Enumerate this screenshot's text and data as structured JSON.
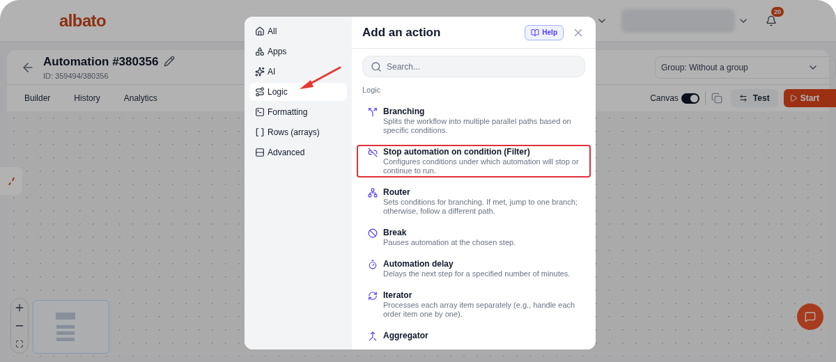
{
  "header": {
    "logo": "albato",
    "notifications": {
      "count": "20"
    }
  },
  "automation": {
    "title": "Automation #380356",
    "id": "ID: 359494/380356",
    "group": "Group: Without a group",
    "tabs": [
      {
        "label": "Builder"
      },
      {
        "label": "History"
      },
      {
        "label": "Analytics"
      }
    ],
    "canvas_toggle": {
      "label": "Canvas",
      "on": true
    },
    "buttons": [
      {
        "label": "Test",
        "kind": "secondary"
      },
      {
        "label": "Start",
        "kind": "primary"
      }
    ]
  },
  "modal": {
    "title": "Add an action",
    "help": "Help",
    "search": {
      "placeholder": "Search..."
    },
    "section": "Logic",
    "categories": [
      {
        "label": "All",
        "kind": "house",
        "selected": false
      },
      {
        "label": "Apps",
        "kind": "shapes",
        "selected": false
      },
      {
        "label": "AI",
        "kind": "sparkles",
        "selected": false
      },
      {
        "label": "Logic",
        "kind": "route",
        "selected": true
      },
      {
        "label": "Formatting",
        "kind": "terminal",
        "selected": false
      },
      {
        "label": "Rows (arrays)",
        "kind": "brackets",
        "selected": false
      },
      {
        "label": "Advanced",
        "kind": "rows",
        "selected": false
      }
    ],
    "actions": [
      {
        "name": "Branching",
        "description": "Splits the workflow into multiple parallel paths based on specific conditions.",
        "kind": "split",
        "highlighted": false
      },
      {
        "name": "Stop automation on condition (Filter)",
        "description": "Configures conditions under which automation will stop or continue to run.",
        "kind": "unlink",
        "highlighted": true
      },
      {
        "name": "Router",
        "description": "Sets conditions for branching. If met, jump to one branch; otherwise, follow a different path.",
        "kind": "network",
        "highlighted": false
      },
      {
        "name": "Break",
        "description": "Pauses automation at the chosen step.",
        "kind": "ban",
        "highlighted": false
      },
      {
        "name": "Automation delay",
        "description": "Delays the next step for a specified number of minutes.",
        "kind": "timer",
        "highlighted": false
      },
      {
        "name": "Iterator",
        "description": "Processes each array item separately (e.g., handle each order item one by one).",
        "kind": "refresh",
        "highlighted": false
      },
      {
        "name": "Aggregator",
        "kind": "merge",
        "highlighted": false
      }
    ]
  }
}
